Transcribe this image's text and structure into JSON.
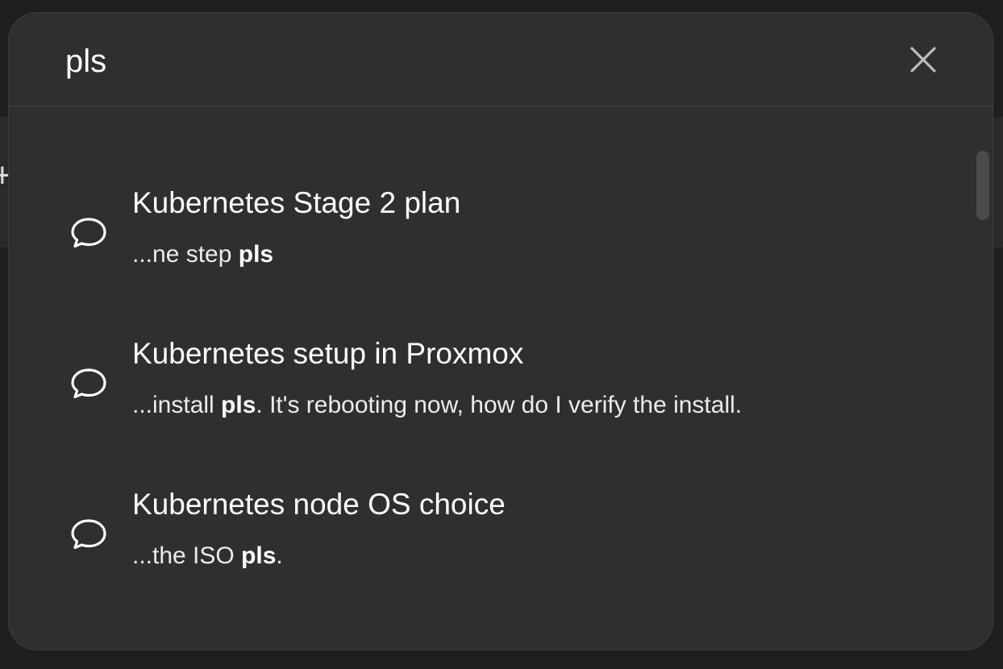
{
  "search": {
    "query": "pls"
  },
  "results": [
    {
      "title": "Kubernetes Stage 2 plan",
      "snippet_before": "...ne step ",
      "snippet_match": "pls",
      "snippet_after": "",
      "icon": "chat-bubble-icon"
    },
    {
      "title": "Kubernetes setup in Proxmox",
      "snippet_before": "...install ",
      "snippet_match": "pls",
      "snippet_after": ". It's rebooting now, how do I verify the install.",
      "icon": "chat-bubble-icon"
    },
    {
      "title": "Kubernetes node OS choice",
      "snippet_before": "...the ISO ",
      "snippet_match": "pls",
      "snippet_after": ".",
      "icon": "chat-bubble-icon"
    }
  ],
  "icons": {
    "close": "close-icon"
  },
  "colors": {
    "modal_bg": "#2f2f2f",
    "backdrop": "#1f1f1f",
    "text": "#ffffff",
    "divider": "#474747"
  }
}
